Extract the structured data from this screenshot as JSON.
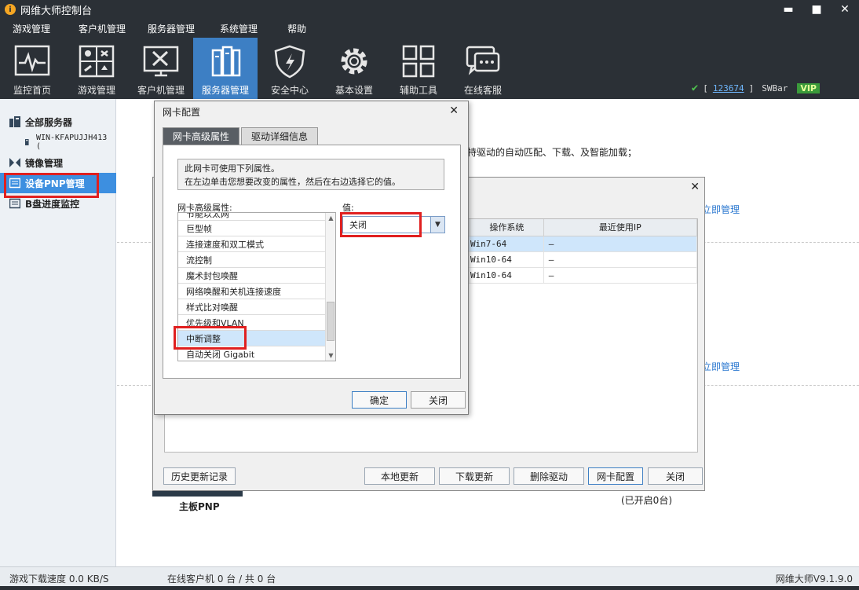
{
  "app": {
    "title": "网维大师控制台",
    "version": "网维大师V9.1.9.0"
  },
  "window_controls": {
    "minimize": "▬",
    "maximize": "■",
    "close": "✕"
  },
  "menu": [
    "游戏管理",
    "客户机管理",
    "服务器管理",
    "系统管理",
    "帮助"
  ],
  "toolbar": [
    {
      "label": "监控首页",
      "icon": "monitor-pulse-icon"
    },
    {
      "label": "游戏管理",
      "icon": "game-cards-icon"
    },
    {
      "label": "客户机管理",
      "icon": "client-tools-icon"
    },
    {
      "label": "服务器管理",
      "icon": "server-icon",
      "active": true
    },
    {
      "label": "安全中心",
      "icon": "shield-icon"
    },
    {
      "label": "基本设置",
      "icon": "gear-icon"
    },
    {
      "label": "辅助工具",
      "icon": "grid-icon"
    },
    {
      "label": "在线客服",
      "icon": "chat-icon"
    }
  ],
  "status": {
    "bracket_open": "[",
    "user_id": "123674",
    "bracket_close": "]",
    "brand": "SWBar",
    "vip": "VIP"
  },
  "sidebar": {
    "items": [
      {
        "label": "全部服务器",
        "icon": "server-group-icon"
      },
      {
        "label": "WIN-KFAPUJJH413 (",
        "icon": "computer-icon",
        "sub": true
      },
      {
        "label": "镜像管理",
        "icon": "mirror-icon"
      },
      {
        "label": "设备PNP管理",
        "icon": "device-icon",
        "active": true
      },
      {
        "label": "B盘进度监控",
        "icon": "disk-icon"
      }
    ]
  },
  "main": {
    "desc_fragment": "持驱动的自动匹配、下载、及智能加载；",
    "manage_link_1": "立即管理",
    "manage_link_2": "立即管理",
    "mb_label": "主板PNP",
    "enabled_count": "(已开启0台)"
  },
  "driver_dialog": {
    "close": "✕",
    "columns": [
      "操作系统",
      "最近使用IP"
    ],
    "rows": [
      {
        "os": "Win7-64",
        "ip": "—"
      },
      {
        "os": "Win10-64",
        "ip": "—"
      },
      {
        "os": "Win10-64",
        "ip": "—"
      }
    ],
    "buttons": {
      "history": "历史更新记录",
      "local_update": "本地更新",
      "download_update": "下载更新",
      "delete_driver": "删除驱动",
      "nic_config": "网卡配置",
      "close": "关闭"
    }
  },
  "nic_dialog": {
    "title": "网卡配置",
    "close": "✕",
    "tabs": [
      "网卡高级属性",
      "驱动详细信息"
    ],
    "desc_line1": "此网卡可使用下列属性。",
    "desc_line2": "在左边单击您想要改变的属性，然后在右边选择它的值。",
    "props_label": "网卡高级属性:",
    "value_label": "值:",
    "value_selected": "关闭",
    "properties": [
      "节能以太网",
      "巨型帧",
      "连接速度和双工模式",
      "流控制",
      "魔术封包唤醒",
      "网络唤醒和关机连接速度",
      "样式比对唤醒",
      "优先级和VLAN",
      "中断调整",
      "自动关闭 Gigabit"
    ],
    "ok": "确定",
    "cancel": "关闭"
  },
  "statusbar": {
    "download": "游戏下载速度 0.0 KB/S",
    "clients": "在线客户机 0 台 / 共 0 台"
  }
}
